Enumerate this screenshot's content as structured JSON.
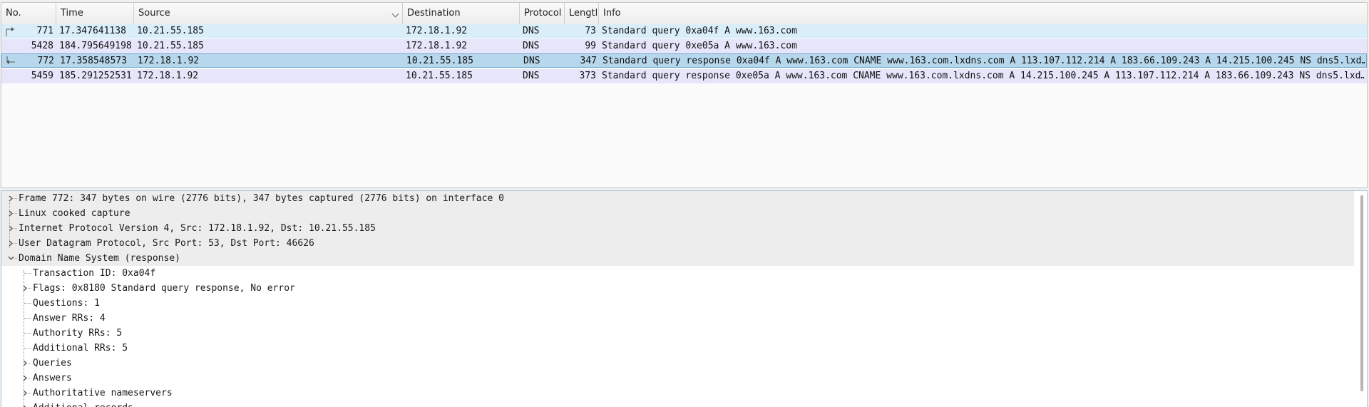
{
  "packet_list": {
    "columns": [
      "No.",
      "Time",
      "Source",
      "Destination",
      "Protocol",
      "Lengtl",
      "Info"
    ],
    "rows": [
      {
        "no": "771",
        "time": "17.347641138",
        "source": "10.21.55.185",
        "destination": "172.18.1.92",
        "protocol": "DNS",
        "length": "73",
        "info": "Standard query 0xa04f A www.163.com",
        "indicator": "request-arrow"
      },
      {
        "no": "5428",
        "time": "184.795649198",
        "source": "10.21.55.185",
        "destination": "172.18.1.92",
        "protocol": "DNS",
        "length": "99",
        "info": "Standard query 0xe05a A www.163.com",
        "indicator": ""
      },
      {
        "no": "772",
        "time": "17.358548573",
        "source": "172.18.1.92",
        "destination": "10.21.55.185",
        "protocol": "DNS",
        "length": "347",
        "info": "Standard query response 0xa04f A www.163.com CNAME www.163.com.lxdns.com A 113.107.112.214 A 183.66.109.243 A 14.215.100.245 NS dns5.lxd…",
        "indicator": "response-arrow"
      },
      {
        "no": "5459",
        "time": "185.291252531",
        "source": "172.18.1.92",
        "destination": "10.21.55.185",
        "protocol": "DNS",
        "length": "373",
        "info": "Standard query response 0xe05a A www.163.com CNAME www.163.com.lxdns.com A 14.215.100.245 A 113.107.112.214 A 183.66.109.243 NS dns5.lxd…",
        "indicator": ""
      }
    ],
    "row_colors": [
      "#daeefa",
      "#e6e5fa",
      "#b6d7ec",
      "#e6e5fa"
    ],
    "selected_row": 2
  },
  "detail_tree": [
    {
      "label": "Frame 772: 347 bytes on wire (2776 bits), 347 bytes captured (2776 bits) on interface 0",
      "level": 0,
      "state": "collapsed"
    },
    {
      "label": "Linux cooked capture",
      "level": 0,
      "state": "collapsed"
    },
    {
      "label": "Internet Protocol Version 4, Src: 172.18.1.92, Dst: 10.21.55.185",
      "level": 0,
      "state": "collapsed"
    },
    {
      "label": "User Datagram Protocol, Src Port: 53, Dst Port: 46626",
      "level": 0,
      "state": "collapsed"
    },
    {
      "label": "Domain Name System (response)",
      "level": 0,
      "state": "expanded"
    },
    {
      "label": "Transaction ID: 0xa04f",
      "level": 1,
      "state": "leaf"
    },
    {
      "label": "Flags: 0x8180 Standard query response, No error",
      "level": 1,
      "state": "collapsed"
    },
    {
      "label": "Questions: 1",
      "level": 1,
      "state": "leaf"
    },
    {
      "label": "Answer RRs: 4",
      "level": 1,
      "state": "leaf"
    },
    {
      "label": "Authority RRs: 5",
      "level": 1,
      "state": "leaf"
    },
    {
      "label": "Additional RRs: 5",
      "level": 1,
      "state": "leaf"
    },
    {
      "label": "Queries",
      "level": 1,
      "state": "collapsed"
    },
    {
      "label": "Answers",
      "level": 1,
      "state": "collapsed"
    },
    {
      "label": "Authoritative nameservers",
      "level": 1,
      "state": "collapsed"
    },
    {
      "label": "Additional records",
      "level": 1,
      "state": "collapsed"
    }
  ],
  "icons": {
    "expand": "chevron-right-icon",
    "collapse": "chevron-down-icon",
    "sort": "chevron-down-icon"
  },
  "colors": {
    "selected_border": "#6fa8d0",
    "detail_border": "#a8c8de",
    "top_level_bg": "#ededed"
  }
}
